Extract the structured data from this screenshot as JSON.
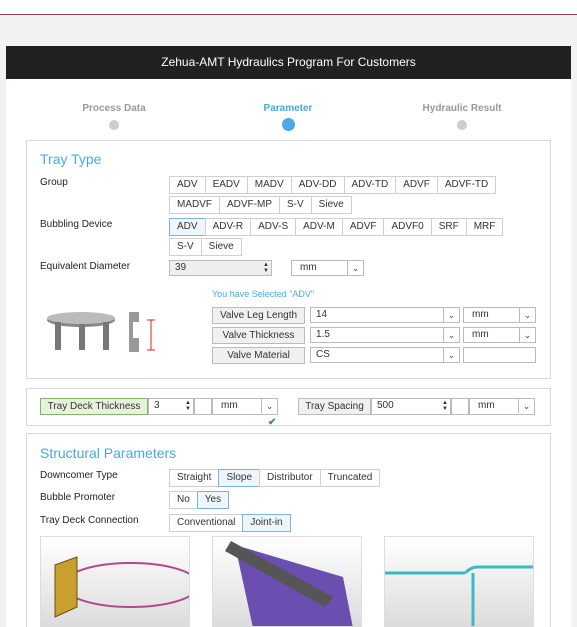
{
  "header": {
    "title": "Zehua-AMT Hydraulics Program For Customers"
  },
  "steps": [
    {
      "label": "Process Data"
    },
    {
      "label": "Parameter"
    },
    {
      "label": "Hydraulic Result"
    }
  ],
  "tray_type": {
    "title": "Tray Type",
    "group_label": "Group",
    "group_row1": [
      "ADV",
      "EADV",
      "MADV",
      "ADV-DD",
      "ADV-TD",
      "ADVF",
      "ADVF-TD"
    ],
    "group_row2": [
      "MADVF",
      "ADVF-MP",
      "S-V",
      "Sieve"
    ],
    "bubbling_label": "Bubbling Device",
    "bubbling_row1": [
      "ADV",
      "ADV-R",
      "ADV-S",
      "ADV-M",
      "ADVF",
      "ADVF0",
      "SRF",
      "MRF"
    ],
    "bubbling_row2": [
      "S-V",
      "Sieve"
    ],
    "eq_diameter_label": "Equivalent Diameter",
    "eq_diameter_value": "39",
    "eq_diameter_unit": "mm",
    "selected_note": "You have Selected  \"ADV\"",
    "valve_leg_label": "Valve Leg Length",
    "valve_leg_value": "14",
    "valve_leg_unit": "mm",
    "valve_thickness_label": "Valve Thickness",
    "valve_thickness_value": "1.5",
    "valve_thickness_unit": "mm",
    "valve_material_label": "Valve Material",
    "valve_material_value": "CS"
  },
  "deck": {
    "thickness_label": "Tray Deck Thickness",
    "thickness_value": "3",
    "thickness_unit": "mm",
    "spacing_label": "Tray Spacing",
    "spacing_value": "500",
    "spacing_unit": "mm",
    "check_icon": "checkmark-icon"
  },
  "structural": {
    "title": "Structural Parameters",
    "downcomer_label": "Downcomer Type",
    "downcomer_options": [
      "Straight",
      "Slope",
      "Distributor",
      "Truncated"
    ],
    "bubble_label": "Bubble Promoter",
    "bubble_options": [
      "No",
      "Yes"
    ],
    "connection_label": "Tray Deck Connection",
    "connection_options": [
      "Conventional",
      "Joint-in"
    ]
  },
  "colors": {
    "accent": "#4aa8e6",
    "header_bg": "#232020",
    "top_line": "#a23a5a"
  }
}
